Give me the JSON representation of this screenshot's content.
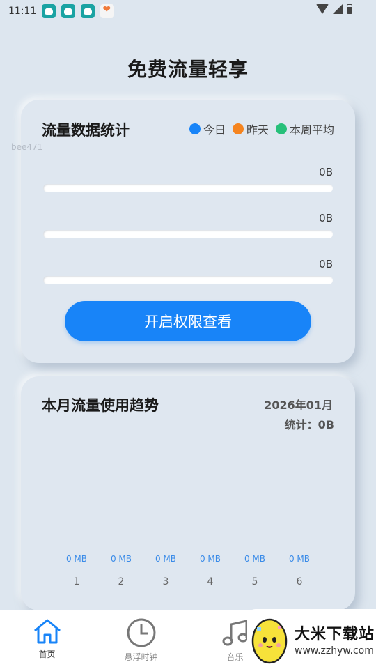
{
  "status_bar": {
    "time": "11:11",
    "notification_icons": [
      "app-icon",
      "app-icon",
      "app-icon",
      "heart-app-icon"
    ]
  },
  "page": {
    "title": "免费流量轻享"
  },
  "stats_card": {
    "title": "流量数据统计",
    "legend": [
      {
        "label": "今日",
        "color": "#1884f8"
      },
      {
        "label": "昨天",
        "color": "#f5841f"
      },
      {
        "label": "本周平均",
        "color": "#27c07a"
      }
    ],
    "watermark_user": "bee471",
    "rows": [
      {
        "value": "0B",
        "fraction": 0
      },
      {
        "value": "0B",
        "fraction": 0
      },
      {
        "value": "0B",
        "fraction": 0
      }
    ],
    "button_label": "开启权限查看"
  },
  "trend_card": {
    "title": "本月流量使用趋势",
    "month": "2026年01月",
    "total": "统计：0B"
  },
  "chart_data": {
    "type": "bar",
    "categories": [
      "1",
      "2",
      "3",
      "4",
      "5",
      "6"
    ],
    "values": [
      0,
      0,
      0,
      0,
      0,
      0
    ],
    "value_labels": [
      "0 MB",
      "0 MB",
      "0 MB",
      "0 MB",
      "0 MB",
      "0 MB"
    ],
    "color": "#3a8be8"
  },
  "tab_bar": {
    "tabs": [
      {
        "label": "首页",
        "icon": "home-icon",
        "active": true
      },
      {
        "label": "悬浮时钟",
        "icon": "clock-icon",
        "active": false
      },
      {
        "label": "音乐",
        "icon": "music-icon",
        "active": false
      },
      {
        "label": "",
        "icon": "more-icon",
        "active": false
      }
    ]
  },
  "watermark_badge": {
    "name": "大米下载站",
    "url": "www.zzhyw.com"
  }
}
